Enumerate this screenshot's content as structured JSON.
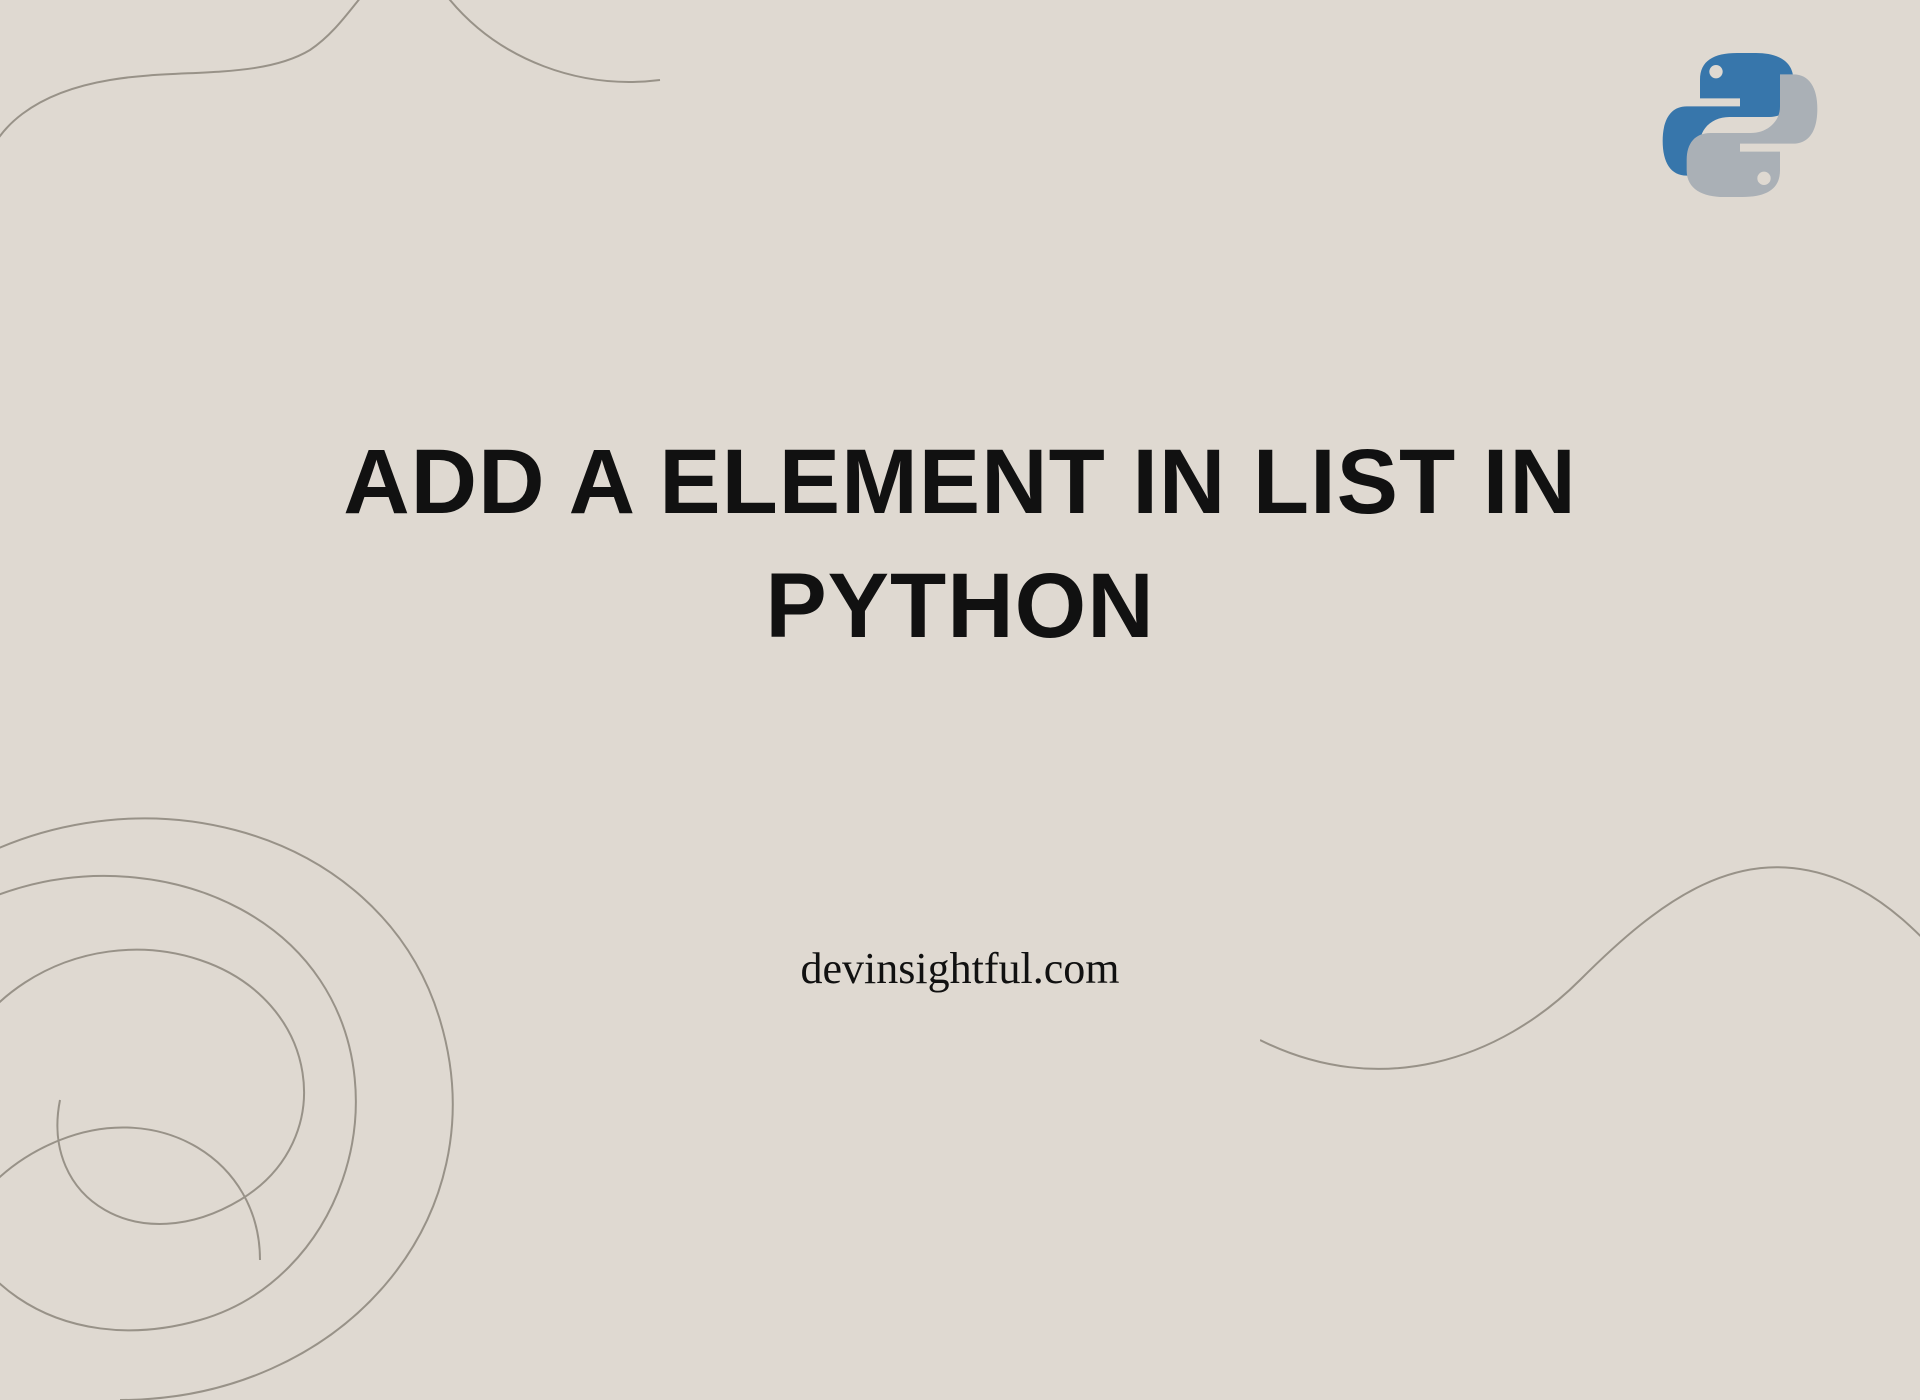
{
  "headline": "ADD A ELEMENT IN LIST IN PYTHON",
  "site": "devinsightful.com",
  "logo_name": "python-logo",
  "colors": {
    "background": "#dfd9d1",
    "line": "#989288",
    "text": "#111111",
    "python_blue": "#3776ab",
    "python_grey": "#aab0b6"
  }
}
